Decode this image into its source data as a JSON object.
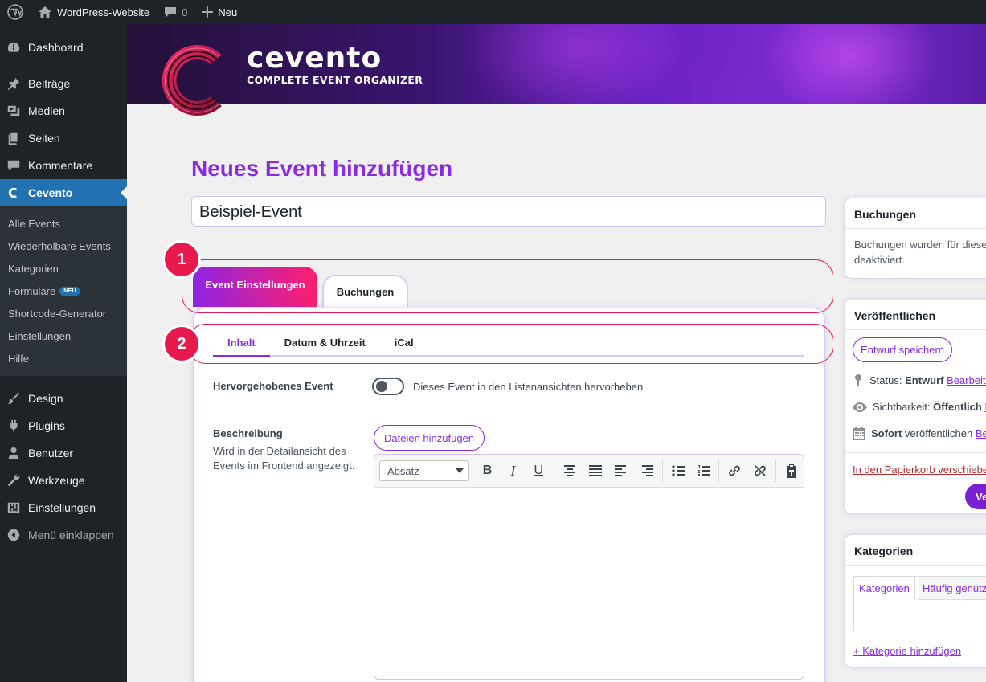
{
  "adminbar": {
    "site_name": "WordPress-Website",
    "comments_count": "0",
    "new_label": "Neu"
  },
  "sidebar": {
    "items_top": [
      {
        "label": "Dashboard",
        "icon": "dashboard-icon"
      },
      {
        "label": "Beiträge",
        "icon": "pin-icon"
      },
      {
        "label": "Medien",
        "icon": "media-icon"
      },
      {
        "label": "Seiten",
        "icon": "pages-icon"
      },
      {
        "label": "Kommentare",
        "icon": "comment-icon"
      }
    ],
    "current": {
      "label": "Cevento",
      "icon": "cevento-icon"
    },
    "submenu": [
      {
        "label": "Alle Events"
      },
      {
        "label": "Wiederholbare Events"
      },
      {
        "label": "Kategorien"
      },
      {
        "label": "Formulare",
        "badge": "NEU"
      },
      {
        "label": "Shortcode-Generator"
      },
      {
        "label": "Einstellungen"
      },
      {
        "label": "Hilfe"
      }
    ],
    "items_bottom": [
      {
        "label": "Design",
        "icon": "brush-icon"
      },
      {
        "label": "Plugins",
        "icon": "plugin-icon"
      },
      {
        "label": "Benutzer",
        "icon": "user-icon"
      },
      {
        "label": "Werkzeuge",
        "icon": "wrench-icon"
      },
      {
        "label": "Einstellungen",
        "icon": "settings-icon"
      }
    ],
    "collapse_label": "Menü einklappen"
  },
  "banner": {
    "brand": "cevento",
    "tagline": "COMPLETE EVENT ORGANIZER"
  },
  "main": {
    "page_title": "Neues Event hinzufügen",
    "event_title_value": "Beispiel-Event",
    "markers": [
      "1",
      "2"
    ],
    "tabs": [
      {
        "label": "Event Einstellungen",
        "active": true
      },
      {
        "label": "Buchungen",
        "active": false
      }
    ],
    "subtabs": [
      {
        "label": "Inhalt",
        "active": true
      },
      {
        "label": "Datum & Uhrzeit",
        "active": false
      },
      {
        "label": "iCal",
        "active": false
      }
    ],
    "featured": {
      "label": "Hervorgehobenes Event",
      "toggle_text": "Dieses Event in den Listenansichten hervorheben",
      "enabled": false
    },
    "description": {
      "label": "Beschreibung",
      "help": "Wird in der Detailansicht des Events im Frontend angezeigt.",
      "add_files_label": "Dateien hinzufügen",
      "format_value": "Absatz"
    }
  },
  "right": {
    "bookings_box": {
      "title": "Buchungen",
      "text_line1": "Buchungen wurden für diese",
      "text_line2": "deaktiviert."
    },
    "publish_box": {
      "title": "Veröffentlichen",
      "save_draft": "Entwurf speichern",
      "status_label": "Status:",
      "status_value": "Entwurf",
      "status_edit": "Bearbeite",
      "visibility_label": "Sichtbarkeit:",
      "visibility_value": "Öffentlich",
      "visibility_edit": "B",
      "schedule_value": "Sofort",
      "schedule_label": "veröffentlichen",
      "schedule_edit": "Be",
      "trash": "In den Papierkorb verschiebe",
      "publish_button": "Ve"
    },
    "categories_box": {
      "title": "Kategorien",
      "tab_all": "Kategorien",
      "tab_popular": "Häufig genutz",
      "add_link": "+ Kategorie hinzufügen"
    }
  },
  "colors": {
    "accent": "#8a2be2",
    "marker": "#e8194d",
    "wp_blue": "#2271b1",
    "sidebar": "#1d2327"
  }
}
